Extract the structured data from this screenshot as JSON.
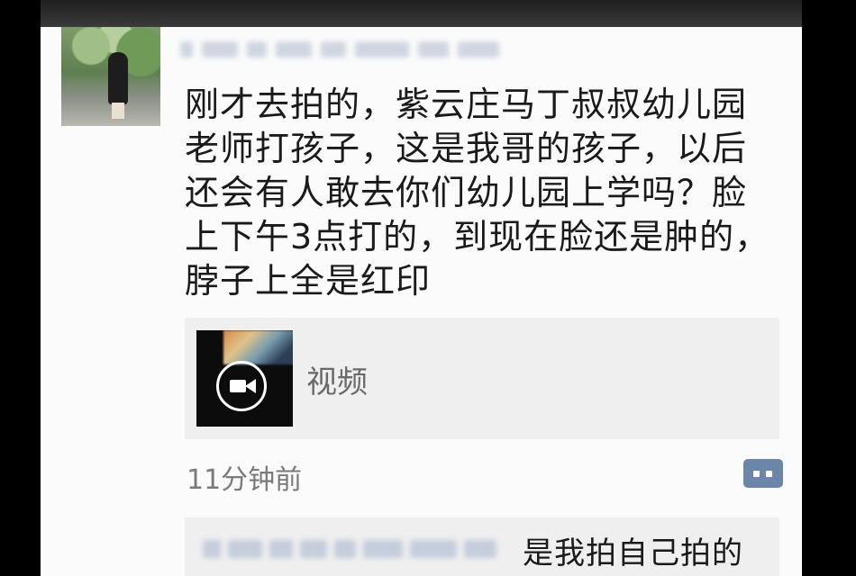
{
  "post": {
    "lines": [
      "刚才去拍的，紫云庄马丁叔叔幼儿园",
      "老师打孩子，这是我哥的孩子，以后",
      "还会有人敢去你们幼儿园上学吗？脸",
      "上下午3点打的，到现在脸还是肿的，",
      "脖子上全是红印"
    ],
    "video_label": "视频",
    "time": "11分钟前"
  },
  "comment": {
    "text": "是我拍自己拍的"
  },
  "icons": {
    "avatar": "user-avatar-photo",
    "video": "video-camera-icon",
    "comment": "comment-more-icon"
  }
}
